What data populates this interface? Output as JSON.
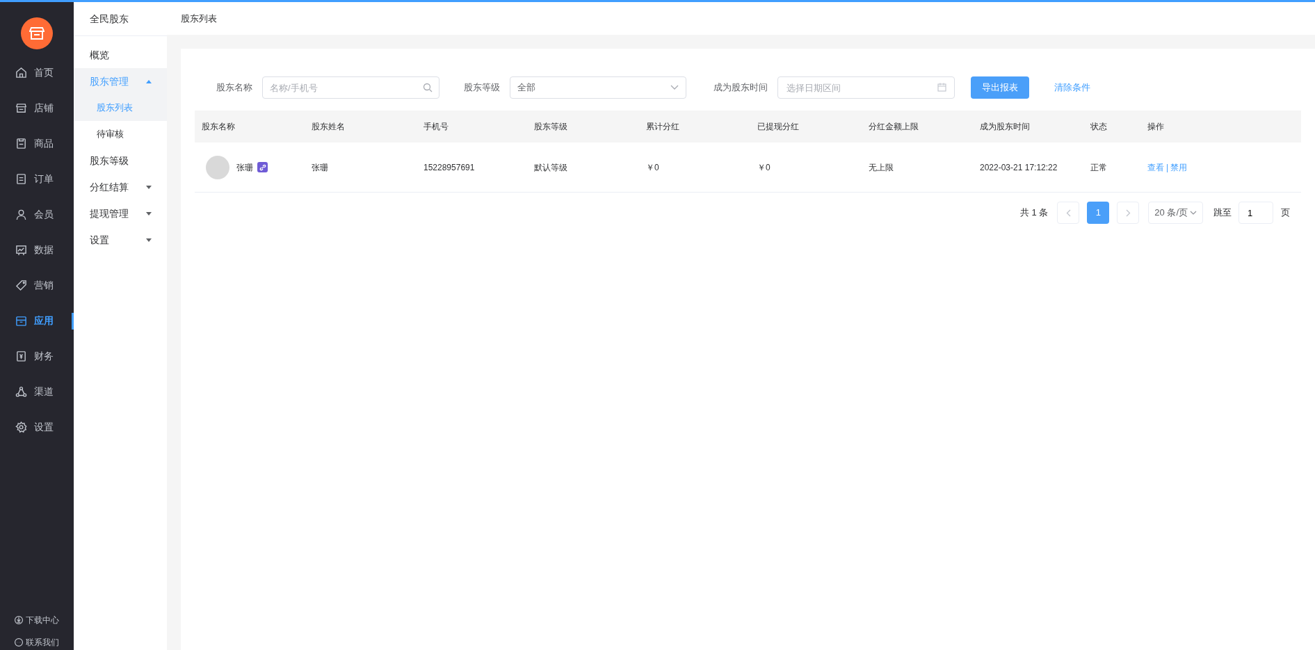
{
  "nav": [
    {
      "label": "首页",
      "selected": false
    },
    {
      "label": "店铺",
      "selected": false
    },
    {
      "label": "商品",
      "selected": false
    },
    {
      "label": "订单",
      "selected": false
    },
    {
      "label": "会员",
      "selected": false
    },
    {
      "label": "数据",
      "selected": false
    },
    {
      "label": "营销",
      "selected": false
    },
    {
      "label": "应用",
      "selected": true
    },
    {
      "label": "财务",
      "selected": false
    },
    {
      "label": "渠道",
      "selected": false
    },
    {
      "label": "设置",
      "selected": false
    }
  ],
  "nav_footer": [
    "下载中心",
    "联系我们"
  ],
  "submenu": {
    "title": "全民股东",
    "items": [
      {
        "label": "概览",
        "selected": false
      },
      {
        "label": "股东管理",
        "selected": false,
        "expanded": true,
        "children": [
          {
            "label": "股东列表",
            "selected": true
          },
          {
            "label": "待审核",
            "selected": false
          }
        ]
      },
      {
        "label": "股东等级",
        "selected": false
      },
      {
        "label": "分红结算",
        "selected": false,
        "expanded": false
      },
      {
        "label": "提现管理",
        "selected": false,
        "expanded": false
      },
      {
        "label": "设置",
        "selected": false,
        "expanded": false
      }
    ]
  },
  "page_title": "股东列表",
  "filters": {
    "name_label": "股东名称",
    "name_placeholder": "名称/手机号",
    "level_label": "股东等级",
    "level_value": "全部",
    "time_label": "成为股东时间",
    "time_placeholder": "选择日期区间",
    "export_button": "导出报表",
    "clear_link": "清除条件"
  },
  "table": {
    "columns": [
      "股东名称",
      "股东姓名",
      "手机号",
      "股东等级",
      "累计分红",
      "已提现分红",
      "分红金额上限",
      "成为股东时间",
      "状态",
      "操作"
    ],
    "rows": [
      {
        "name": "张珊",
        "real_name": "张珊",
        "phone": "15228957691",
        "level": "默认等级",
        "total_dividend": "￥0",
        "withdrawn": "￥0",
        "limit": "无上限",
        "joined": "2022-03-21 17:12:22",
        "status": "正常",
        "actions": [
          "查看",
          "禁用"
        ],
        "separator": "|"
      }
    ]
  },
  "pagination": {
    "total": "共 1 条",
    "pages": [
      {
        "label": "1",
        "selected": true
      }
    ],
    "page_size": "20 条/页",
    "jump_label": "跳至",
    "jump_value": "1",
    "page_unit": "页"
  }
}
